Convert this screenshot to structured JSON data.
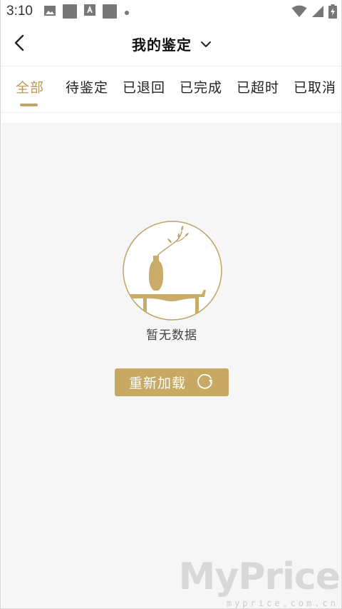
{
  "status_bar": {
    "time": "3:10",
    "icons": [
      "image-icon",
      "square-icon",
      "a-square-icon",
      "square-icon",
      "dot-icon",
      "wifi-icon",
      "signal-icon",
      "battery-charging-icon"
    ]
  },
  "header": {
    "title": "我的鉴定",
    "back_icon": "chevron-left-icon",
    "dropdown_icon": "chevron-down-icon"
  },
  "tabs": [
    {
      "label": "全部",
      "active": true
    },
    {
      "label": "待鉴定",
      "active": false
    },
    {
      "label": "已退回",
      "active": false
    },
    {
      "label": "已完成",
      "active": false
    },
    {
      "label": "已超时",
      "active": false
    },
    {
      "label": "已取消",
      "active": false
    }
  ],
  "empty_state": {
    "message": "暂无数据",
    "reload_label": "重新加载",
    "illustration": "vase-on-table-icon"
  },
  "watermark": {
    "brand": "MyPrice",
    "domain": "myprice.com.cn"
  },
  "colors": {
    "accent": "#c8a964",
    "active_tab": "#b8995a",
    "background": "#f6f6f6"
  }
}
